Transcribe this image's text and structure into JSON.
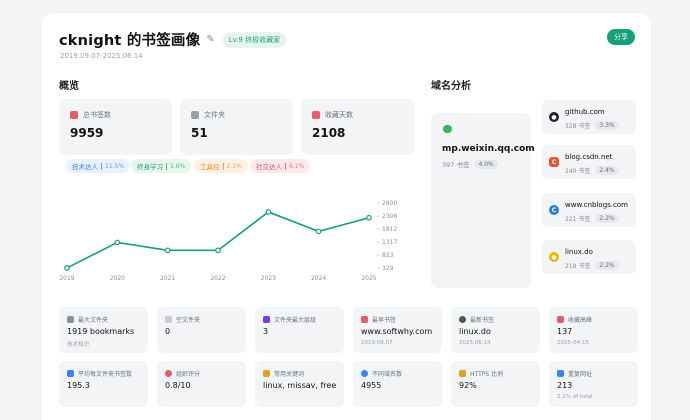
{
  "header": {
    "title": "cknight 的书签画像",
    "level_badge": "Lv.9 终极收藏家",
    "date_range": "2019.09.07-2025.06.14",
    "share_label": "分享"
  },
  "overview": {
    "section_title": "概览",
    "stats": [
      {
        "label": "总书签数",
        "value": "9959",
        "icon": "bookmark-icon",
        "color": "#e35d6a"
      },
      {
        "label": "文件夹",
        "value": "51",
        "icon": "folder-icon",
        "color": "#9aa0a6"
      },
      {
        "label": "收藏天数",
        "value": "2108",
        "icon": "calendar-icon",
        "color": "#e35d6a"
      }
    ],
    "tags": [
      {
        "label": "技术达人",
        "pct": "11.5%",
        "color": "#3b82f6",
        "bg": "#e8f1fd"
      },
      {
        "label": "终身学习",
        "pct": "1.6%",
        "color": "#22a06b",
        "bg": "#e6f6ee"
      },
      {
        "label": "工具控",
        "pct": "2.1%",
        "color": "#e08a1e",
        "bg": "#fdf2e2"
      },
      {
        "label": "社交达人",
        "pct": "6.1%",
        "color": "#e04f6a",
        "bg": "#fde8ec"
      }
    ]
  },
  "chart_data": {
    "type": "line",
    "x": [
      "2019",
      "2020",
      "2021",
      "2022",
      "2023",
      "2024",
      "2025"
    ],
    "values": [
      330,
      1300,
      1000,
      1000,
      2460,
      1720,
      2240
    ],
    "y_ticks": [
      "2800",
      "2306",
      "1812",
      "1317",
      "823",
      "329"
    ],
    "ylim": [
      329,
      2800
    ],
    "color": "#11a07a",
    "grid": false
  },
  "domains": {
    "section_title": "域名分析",
    "top": {
      "name": "mp.weixin.qq.com",
      "count": "397 书签",
      "pct": "4.0%",
      "icon": "wechat-icon"
    },
    "list": [
      {
        "name": "github.com",
        "count": "328 书签",
        "pct": "3.3%",
        "icon": "github-icon",
        "color": "#1f2328",
        "glyph": "●"
      },
      {
        "name": "blog.csdn.net",
        "count": "240 书签",
        "pct": "2.4%",
        "icon": "csdn-icon",
        "color": "#e8552e",
        "glyph": "C"
      },
      {
        "name": "www.cnblogs.com",
        "count": "221 书签",
        "pct": "2.2%",
        "icon": "cnblogs-icon",
        "color": "#2d7fd3",
        "glyph": "C"
      },
      {
        "name": "linux.do",
        "count": "218 书签",
        "pct": "2.2%",
        "icon": "linuxdo-icon",
        "color": "#f2b300",
        "glyph": "●"
      }
    ]
  },
  "metrics": [
    {
      "label": "最大文件夹",
      "value": "1919 bookmarks",
      "sub": "技术知识",
      "icon": "folder-icon",
      "color": "#8a8f98"
    },
    {
      "label": "空文件夹",
      "value": "0",
      "sub": "",
      "icon": "empty-folder-icon",
      "color": "#9aa0a6"
    },
    {
      "label": "文件夹最大层级",
      "value": "3",
      "sub": "",
      "icon": "chart-icon",
      "color": "#7c3aed"
    },
    {
      "label": "最早书签",
      "value": "www.softwhy.com",
      "sub": "2019.09.07",
      "icon": "calendar-icon",
      "color": "#e35d6a"
    },
    {
      "label": "最新书签",
      "value": "linux.do",
      "sub": "2025.06.14",
      "icon": "refresh-icon",
      "color": "#4b5563"
    },
    {
      "label": "收藏高峰",
      "value": "137",
      "sub": "2025-04-15",
      "icon": "trend-icon",
      "color": "#e35d6a"
    },
    {
      "label": "平均每文件夹书签数",
      "value": "195.3",
      "sub": "",
      "icon": "bar-chart-icon",
      "color": "#3b82f6"
    },
    {
      "label": "组织评分",
      "value": "0.8/10",
      "sub": "",
      "icon": "target-icon",
      "color": "#e35d6a"
    },
    {
      "label": "常用关键词",
      "value": "linux, missav, free",
      "sub": "",
      "icon": "key-icon",
      "color": "#e0a21e"
    },
    {
      "label": "不同域名数",
      "value": "4955",
      "sub": "",
      "icon": "globe-icon",
      "color": "#3b82f6"
    },
    {
      "label": "HTTPS 比例",
      "value": "92%",
      "sub": "",
      "icon": "lock-icon",
      "color": "#e0a21e"
    },
    {
      "label": "重复网址",
      "value": "213",
      "sub": "2.1% of total",
      "icon": "duplicate-icon",
      "color": "#3b82f6"
    }
  ]
}
